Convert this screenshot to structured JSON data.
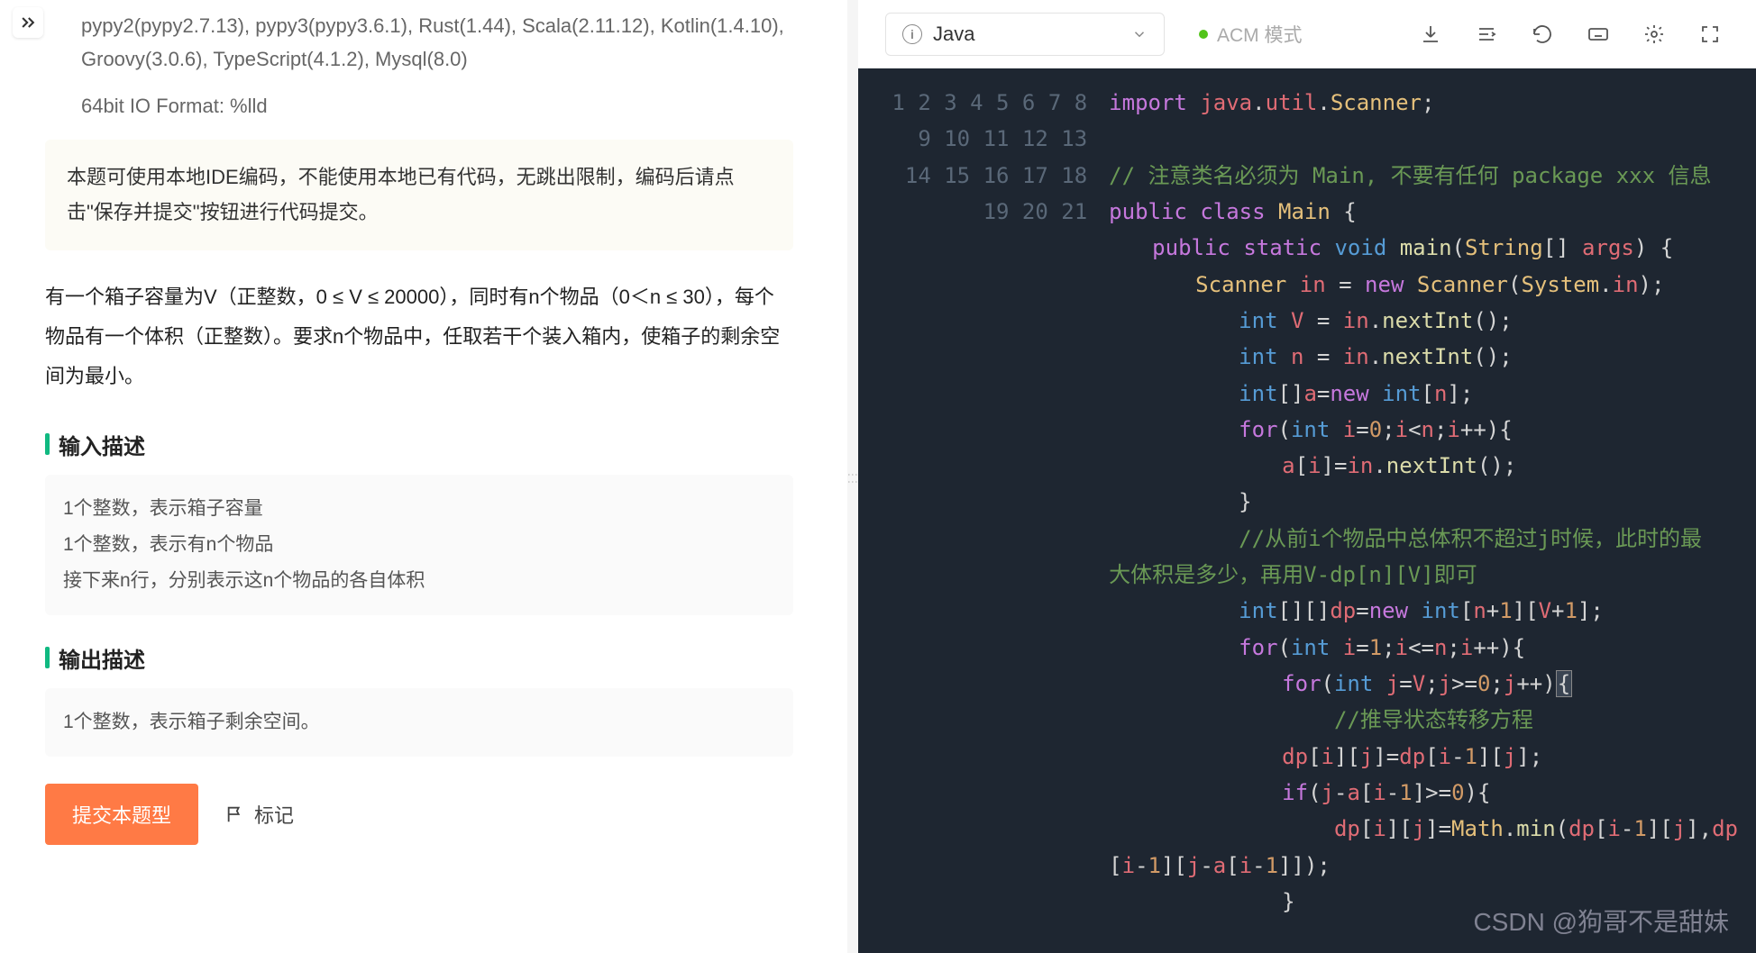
{
  "left": {
    "languages": "pypy2(pypy2.7.13), pypy3(pypy3.6.1), Rust(1.44), Scala(2.11.12), Kotlin(1.4.10), Groovy(3.0.6), TypeScript(4.1.2), Mysql(8.0)",
    "io_format": "64bit IO Format: %lld",
    "notice": "本题可使用本地IDE编码，不能使用本地已有代码，无跳出限制，编码后请点击\"保存并提交\"按钮进行代码提交。",
    "problem": "有一个箱子容量为V（正整数，0 ≤ V ≤ 20000），同时有n个物品（0＜n ≤ 30），每个物品有一个体积（正整数）。要求n个物品中，任取若干个装入箱内，使箱子的剩余空间为最小。",
    "input_title": "输入描述",
    "input_desc_l1": "1个整数，表示箱子容量",
    "input_desc_l2": "1个整数，表示有n个物品",
    "input_desc_l3": "接下来n行，分别表示这n个物品的各自体积",
    "output_title": "输出描述",
    "output_desc": "1个整数，表示箱子剩余空间。",
    "submit": "提交本题型",
    "flag": "标记"
  },
  "toolbar": {
    "language": "Java",
    "mode": "ACM 模式"
  },
  "code": {
    "l1": "import java.util.Scanner;",
    "l3": "// 注意类名必须为 Main, 不要有任何 package xxx 信息",
    "l4": "public class Main {",
    "l5": "public static void main(String[] args) {",
    "l6": "Scanner in = new Scanner(System.in);",
    "l7": "int V = in.nextInt();",
    "l8": "int n = in.nextInt();",
    "l9": "int[]a=new int[n];",
    "l10": "for(int i=0;i<n;i++){",
    "l11": "a[i]=in.nextInt();",
    "l12": "}",
    "l13a": "//从前i个物品中总体积不超过j时候，此时的最",
    "l13b": "大体积是多少，再用V-dp[n][V]即可",
    "l14": "int[][]dp=new int[n+1][V+1];",
    "l15": "for(int i=1;i<=n;i++){",
    "l16": "for(int j=V;j>=0;j++){",
    "l17": "//推导状态转移方程",
    "l18": "dp[i][j]=dp[i-1][j];",
    "l19": "if(j-a[i-1]>=0){",
    "l20a": "dp[i][j]=Math.min(dp[i-1][j],dp",
    "l20b": "[i-1][j-a[i-1]]);",
    "l21": "}"
  },
  "watermark": "CSDN @狗哥不是甜妹"
}
